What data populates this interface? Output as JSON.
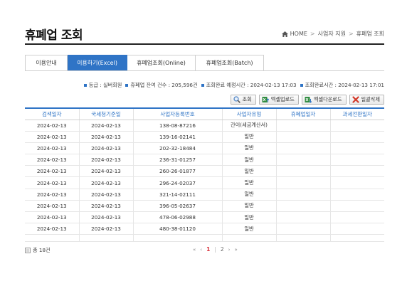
{
  "header": {
    "title": "휴폐업 조회",
    "breadcrumb": [
      "HOME",
      "사업자 지원",
      "휴폐업 조회"
    ]
  },
  "tabs": [
    {
      "label": "이용안내",
      "active": false
    },
    {
      "label": "이용하기(Excel)",
      "active": true
    },
    {
      "label": "휴폐업조회(Online)",
      "active": false
    },
    {
      "label": "휴폐업조회(Batch)",
      "active": false
    }
  ],
  "info": [
    "등급 : 실버회원",
    "휴폐업 잔여 건수 : 205,596건",
    "조회완료 예정시간 : 2024-02-13 17:03",
    "조회완료시간 : 2024-02-13 17:01"
  ],
  "buttons": {
    "search": "조회",
    "excel_upload": "엑셀업로드",
    "excel_download": "엑셀다운로드",
    "delete_all": "일괄삭제"
  },
  "table": {
    "columns": [
      "검색일자",
      "국세청기준일",
      "사업자등록번호",
      "사업자유형",
      "휴폐업일자",
      "과세전환일자"
    ],
    "rows": [
      [
        "2024-02-13",
        "2024-02-13",
        "138-08-87216",
        "간이(세금계산서)",
        "",
        ""
      ],
      [
        "2024-02-13",
        "2024-02-13",
        "139-16-02141",
        "일반",
        "",
        ""
      ],
      [
        "2024-02-13",
        "2024-02-13",
        "202-32-18484",
        "일반",
        "",
        ""
      ],
      [
        "2024-02-13",
        "2024-02-13",
        "236-31-01257",
        "일반",
        "",
        ""
      ],
      [
        "2024-02-13",
        "2024-02-13",
        "260-26-01877",
        "일반",
        "",
        ""
      ],
      [
        "2024-02-13",
        "2024-02-13",
        "296-24-02037",
        "일반",
        "",
        ""
      ],
      [
        "2024-02-13",
        "2024-02-13",
        "321-14-02111",
        "일반",
        "",
        ""
      ],
      [
        "2024-02-13",
        "2024-02-13",
        "396-05-02637",
        "일반",
        "",
        ""
      ],
      [
        "2024-02-13",
        "2024-02-13",
        "478-06-02988",
        "일반",
        "",
        ""
      ],
      [
        "2024-02-13",
        "2024-02-13",
        "480-38-01120",
        "일반",
        "",
        ""
      ]
    ]
  },
  "footer": {
    "total": "총 18건",
    "pager": {
      "first": "«",
      "prev": "‹",
      "pages": [
        "1",
        "2"
      ],
      "current": "1",
      "next": "›",
      "last": "»"
    }
  },
  "colors": {
    "accent": "#2f74c6",
    "current_page": "#d9303a"
  }
}
